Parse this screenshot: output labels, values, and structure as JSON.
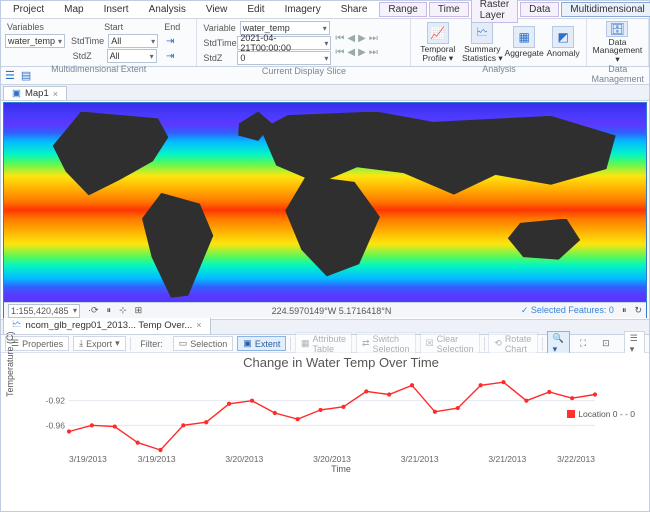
{
  "menu": {
    "items": [
      "Project",
      "Map",
      "Insert",
      "Analysis",
      "View",
      "Edit",
      "Imagery",
      "Share"
    ],
    "context_groups": [
      {
        "items": [
          "Range",
          "Time"
        ]
      },
      {
        "items": [
          "Raster Layer",
          "Data",
          "Multidimensional"
        ],
        "active_index": 2
      }
    ]
  },
  "ribbon": {
    "variables_label": "Variables",
    "variable_value": "water_temp",
    "start_label": "Start",
    "end_label": "End",
    "stdtime_label": "StdTime",
    "stdz_label": "StdZ",
    "stdtime_start": "All",
    "stdz_start": "All",
    "stdtime_end": "",
    "stdz_end": "",
    "extent_caption": "Multidimensional Extent",
    "slice_variable_label": "Variable",
    "slice_variable_value": "water_temp",
    "slice_stdtime_value": "2021-04-21T00:00:00",
    "slice_stdz_value": "0",
    "slice_caption": "Current Display Slice",
    "analysis_caption": "Analysis",
    "datamgmt_caption": "Data Management",
    "temporal_profile": "Temporal Profile",
    "summary_stats": "Summary Statistics",
    "aggregate": "Aggregate",
    "anomaly": "Anomaly",
    "data_mgmt": "Data Management"
  },
  "map_tab": "Map1",
  "map_status": {
    "scale": "1:155,420,485",
    "coords": "224.5970149°W 5.1716418°N",
    "selected": "Selected Features: 0"
  },
  "chart_tab": "ncom_glb_regp01_2013... Temp Over...",
  "chart_toolbar": {
    "properties": "Properties",
    "export": "Export",
    "filter": "Filter:",
    "selection": "Selection",
    "extent": "Extent",
    "attr_table": "Attribute Table",
    "switch_sel": "Switch Selection",
    "clear_sel": "Clear Selection",
    "rotate": "Rotate Chart"
  },
  "chart_data": {
    "type": "line",
    "title": "Change in Water Temp Over Time",
    "xlabel": "Time",
    "ylabel": "Temperature (C)",
    "ylim": [
      -1.0,
      -0.88
    ],
    "yticks": [
      -0.92,
      -0.96
    ],
    "xticks": [
      "3/19/2013",
      "3/19/2013",
      "3/20/2013",
      "3/20/2013",
      "3/21/2013",
      "3/21/2013",
      "3/22/2013"
    ],
    "series": [
      {
        "name": "Location 0 - - 0",
        "values": [
          -0.97,
          -0.96,
          -0.962,
          -0.988,
          -1.0,
          -0.96,
          -0.955,
          -0.925,
          -0.92,
          -0.94,
          -0.95,
          -0.935,
          -0.93,
          -0.905,
          -0.91,
          -0.895,
          -0.938,
          -0.932,
          -0.895,
          -0.89,
          -0.92,
          -0.906,
          -0.916,
          -0.91
        ]
      }
    ]
  }
}
